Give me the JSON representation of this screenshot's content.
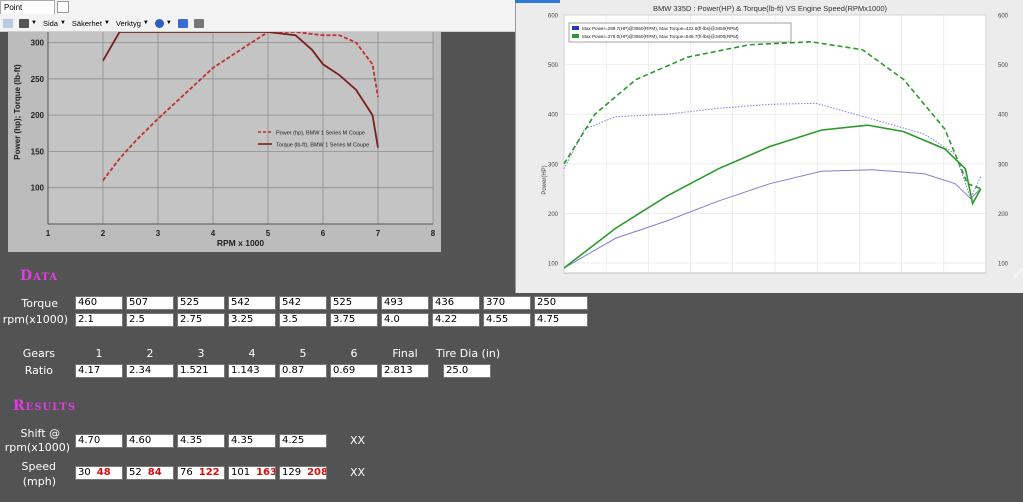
{
  "browser": {
    "tab_label": "Point",
    "toolbar": {
      "page_label": "Sida",
      "security_label": "Säkerhet",
      "tools_label": "Verktyg"
    }
  },
  "left_chart": {
    "chart_data": {
      "type": "line",
      "ylabel": "Power (hp); Torque (lb-ft)",
      "xlabel": "RPM x 1000",
      "xlim": [
        1,
        8
      ],
      "ylim": [
        50,
        320
      ],
      "xticks": [
        "1",
        "2",
        "3",
        "4",
        "5",
        "6",
        "7",
        "8"
      ],
      "yticks": [
        "100",
        "150",
        "200",
        "250",
        "300"
      ],
      "grid": true,
      "legend_position": "center-right",
      "series": [
        {
          "name": "Power (hp), BMW 1 Series M Coupe",
          "style": "dashed",
          "color": "#c03030",
          "x": [
            2.0,
            2.3,
            2.6,
            3.0,
            3.5,
            4.0,
            4.5,
            5.0,
            5.5,
            6.0,
            6.3,
            6.6,
            6.9,
            7.0
          ],
          "y": [
            110,
            140,
            165,
            195,
            230,
            265,
            290,
            318,
            325,
            310,
            310,
            300,
            270,
            225
          ]
        },
        {
          "name": "Torque (lb-ft), BMW 1 Series M Coupe",
          "style": "solid",
          "color": "#7a1f1f",
          "x": [
            2.0,
            2.3,
            2.6,
            3.0,
            3.5,
            4.0,
            4.5,
            5.0,
            5.5,
            5.8,
            6.0,
            6.3,
            6.6,
            6.9,
            7.0
          ],
          "y": [
            275,
            315,
            330,
            330,
            330,
            330,
            330,
            330,
            310,
            290,
            270,
            255,
            235,
            200,
            155
          ]
        }
      ]
    }
  },
  "popup_chart": {
    "chart_data": {
      "type": "line",
      "title": "BMW 335D : Power(HP) & Torque(lb-ft) VS Engine Speed(RPMx1000)",
      "ylabel": "Power(HP)",
      "ylim": [
        80,
        600
      ],
      "yticks": [
        "100",
        "200",
        "300",
        "400",
        "500",
        "600"
      ],
      "xlim": [
        1.0,
        5.1
      ],
      "grid": true,
      "legend_position": "top-left",
      "legend": [
        "Max Power=288.7(HP)@3950(RPM), Max Torque=422.8(ft-lbs)@3450(RPM)",
        "Max Power=378.0(HP)@3950(RPM), Max Torque=546.7(ft-lbs)@3400(RPM)"
      ],
      "series": [
        {
          "style": "solid",
          "color": "#8080d0",
          "x": [
            1.0,
            1.5,
            2.0,
            2.5,
            3.0,
            3.5,
            4.0,
            4.5,
            4.8,
            4.95,
            5.05
          ],
          "y": [
            90,
            150,
            185,
            225,
            260,
            285,
            288,
            280,
            260,
            230,
            250
          ]
        },
        {
          "style": "dotted",
          "color": "#8080d0",
          "x": [
            1.0,
            1.2,
            1.5,
            2.0,
            2.5,
            3.0,
            3.45,
            4.0,
            4.5,
            4.8,
            4.95,
            5.05
          ],
          "y": [
            290,
            370,
            395,
            400,
            412,
            420,
            422,
            390,
            360,
            320,
            230,
            275
          ]
        },
        {
          "style": "solid",
          "color": "#2a9a2a",
          "x": [
            1.0,
            1.5,
            2.0,
            2.5,
            3.0,
            3.5,
            3.95,
            4.3,
            4.7,
            4.9,
            4.97,
            5.05
          ],
          "y": [
            90,
            170,
            235,
            290,
            335,
            368,
            378,
            365,
            330,
            290,
            220,
            250
          ]
        },
        {
          "style": "dashed",
          "color": "#2a9a2a",
          "x": [
            1.0,
            1.3,
            1.7,
            2.2,
            2.8,
            3.4,
            3.9,
            4.3,
            4.7,
            4.92,
            5.05
          ],
          "y": [
            300,
            400,
            470,
            515,
            540,
            546,
            530,
            470,
            370,
            260,
            250
          ]
        }
      ],
      "right_yticks": [
        "100",
        "200",
        "300",
        "400",
        "500",
        "600"
      ]
    }
  },
  "data_section": {
    "title": "Data",
    "torque_label": "Torque",
    "rpm_label": "rpm(x1000)",
    "torque": [
      "460",
      "507",
      "525",
      "542",
      "542",
      "525",
      "493",
      "436",
      "370",
      "250"
    ],
    "rpm": [
      "2.1",
      "2.5",
      "2.75",
      "3.25",
      "3.5",
      "3.75",
      "4.0",
      "4.22",
      "4.55",
      "4.75"
    ]
  },
  "gears_section": {
    "gears_label": "Gears",
    "ratio_label": "Ratio",
    "headers": [
      "1",
      "2",
      "3",
      "4",
      "5",
      "6",
      "Final",
      "Tire Dia (in)"
    ],
    "ratios": [
      "4.17",
      "2.34",
      "1.521",
      "1.143",
      "0.87",
      "0.69",
      "2.813",
      "25.0"
    ]
  },
  "results_section": {
    "title": "Results",
    "shift_label_1": "Shift @",
    "shift_label_2": "rpm(x1000)",
    "shift": [
      "4.70",
      "4.60",
      "4.35",
      "4.35",
      "4.25"
    ],
    "speed_label_1": "Speed",
    "speed_label_2": "(mph)",
    "speed": [
      {
        "mph": "30",
        "kmh": "48"
      },
      {
        "mph": "52",
        "kmh": "84"
      },
      {
        "mph": "76",
        "kmh": "122"
      },
      {
        "mph": "101",
        "kmh": "163"
      },
      {
        "mph": "129",
        "kmh": "208"
      }
    ],
    "xx_1": "XX",
    "xx_2": "XX"
  }
}
